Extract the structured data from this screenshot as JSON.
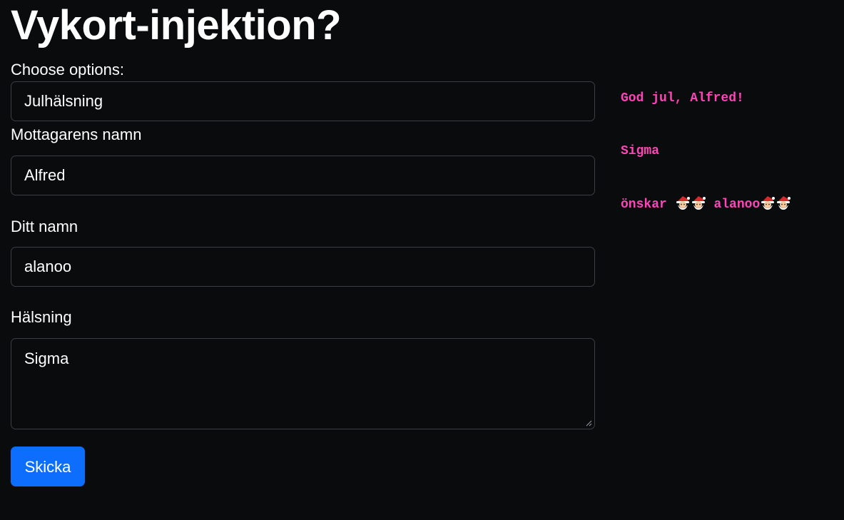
{
  "heading": "Vykort-injektion?",
  "form": {
    "options_label": "Choose options:",
    "options_value": "Julhälsning",
    "recipient_label": "Mottagarens namn",
    "recipient_value": "Alfred",
    "sender_label": "Ditt namn",
    "sender_value": "alanoo",
    "greeting_label": "Hälsning",
    "greeting_value": "Sigma",
    "submit_label": "Skicka"
  },
  "preview": {
    "line1": "God jul, Alfred!",
    "line2": "Sigma",
    "wishes_word": "önskar",
    "sender_name": "alanoo",
    "emoji_icon": "santa-claus-icon"
  },
  "colors": {
    "background": "#090b0d",
    "accent_button": "#0d6efd",
    "preview_text": "#ff44b8",
    "field_border": "#3a3f44"
  }
}
